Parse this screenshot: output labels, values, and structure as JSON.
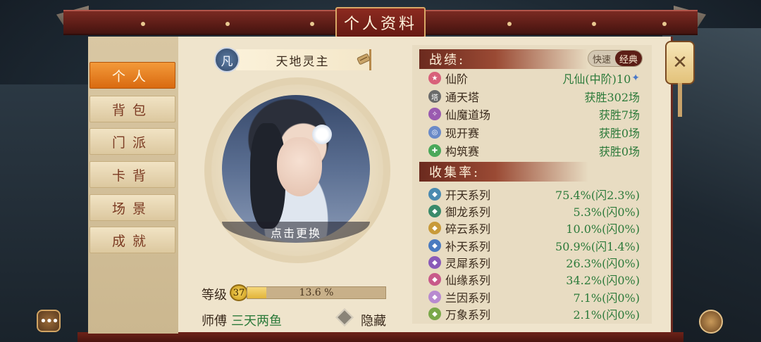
{
  "window": {
    "title": "个人资料"
  },
  "sidebar": {
    "items": [
      {
        "label": "个人",
        "active": true
      },
      {
        "label": "背包",
        "active": false
      },
      {
        "label": "门派",
        "active": false
      },
      {
        "label": "卡背",
        "active": false
      },
      {
        "label": "场景",
        "active": false
      },
      {
        "label": "成就",
        "active": false
      }
    ]
  },
  "profile": {
    "rank_glyph": "凡",
    "name": "天地灵主",
    "change_avatar_label": "点击更换",
    "level_label": "等级",
    "level": "37",
    "exp_percent_text": "13.6 %",
    "exp_fraction": 0.136,
    "master_label": "师傅",
    "master_name": "三天两鱼",
    "hide_label": "隐藏"
  },
  "record": {
    "title": "战绩:",
    "toggle_left": "快速",
    "toggle_right": "经典",
    "rows": [
      {
        "label": "仙阶",
        "value": "凡仙(中阶)10",
        "icon": "star-icon",
        "color": "#d8607a"
      },
      {
        "label": "通天塔",
        "value": "获胜302场",
        "icon": "tower-icon",
        "color": "#6a6a6a"
      },
      {
        "label": "仙魔道场",
        "value": "获胜7场",
        "icon": "arena-icon",
        "color": "#9a5ab0"
      },
      {
        "label": "现开赛",
        "value": "获胜0场",
        "icon": "match-icon",
        "color": "#6a8ac8"
      },
      {
        "label": "构筑赛",
        "value": "获胜0场",
        "icon": "build-icon",
        "color": "#4aa85a"
      }
    ]
  },
  "collection": {
    "title": "收集率:",
    "rows": [
      {
        "label": "开天系列",
        "value": "75.4%(闪2.3%)",
        "color": "#4a8ab0"
      },
      {
        "label": "御龙系列",
        "value": "5.3%(闪0%)",
        "color": "#3a8a6a"
      },
      {
        "label": "碎云系列",
        "value": "10.0%(闪0%)",
        "color": "#c89a3a"
      },
      {
        "label": "补天系列",
        "value": "50.9%(闪1.4%)",
        "color": "#4a7ac0"
      },
      {
        "label": "灵犀系列",
        "value": "26.3%(闪0%)",
        "color": "#8a5ab8"
      },
      {
        "label": "仙缘系列",
        "value": "34.2%(闪0%)",
        "color": "#c85a8a"
      },
      {
        "label": "兰因系列",
        "value": "7.1%(闪0%)",
        "color": "#b88ad0"
      },
      {
        "label": "万象系列",
        "value": "2.1%(闪0%)",
        "color": "#7aa84a"
      }
    ]
  },
  "icons": {
    "lantern": "close-icon",
    "chat": "chat-icon",
    "corner": "menu-icon",
    "edit": "edit-icon"
  }
}
